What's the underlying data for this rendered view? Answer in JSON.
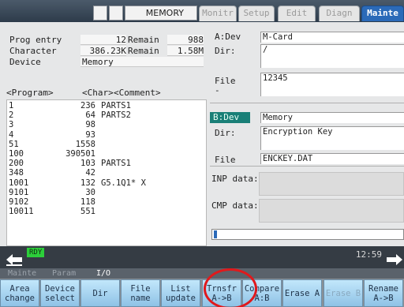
{
  "topbar": {
    "mode": "MEMORY",
    "tabs": [
      "Monitr",
      "Setup",
      "Edit",
      "Diagn",
      "Mainte"
    ],
    "active_tab_index": 4
  },
  "info": {
    "prog_entry_label": "Prog entry",
    "prog_entry_value": "12",
    "remain_label": "Remain",
    "prog_remain_value": "988",
    "character_label": "Character",
    "character_value": "386.23K",
    "char_remain_value": "1.58M",
    "device_label": "Device",
    "device_value": "Memory"
  },
  "list_header": {
    "program": "<Program>",
    "char": "<Char>",
    "comment": "<Comment>"
  },
  "programs": [
    {
      "name": "1",
      "size": "236",
      "comment": "PARTS1"
    },
    {
      "name": "2",
      "size": "64",
      "comment": "PARTS2"
    },
    {
      "name": "3",
      "size": "98",
      "comment": ""
    },
    {
      "name": "4",
      "size": "93",
      "comment": ""
    },
    {
      "name": "51",
      "size": "1558",
      "comment": ""
    },
    {
      "name": "100",
      "size": "390501",
      "comment": ""
    },
    {
      "name": "200",
      "size": "103",
      "comment": "PARTS1"
    },
    {
      "name": "348",
      "size": "42",
      "comment": ""
    },
    {
      "name": "1001",
      "size": "132",
      "comment": "G5.1Q1* X"
    },
    {
      "name": "9101",
      "size": "30",
      "comment": ""
    },
    {
      "name": "9102",
      "size": "118",
      "comment": ""
    },
    {
      "name": "10011",
      "size": "551",
      "comment": ""
    }
  ],
  "device_a": {
    "dev_label": "A:Dev",
    "dev_value": "M-Card",
    "dir_label": "Dir:",
    "dir_value": "/",
    "file_label": "File",
    "file_value": "12345",
    "extra_label": "-"
  },
  "device_b": {
    "dev_label": "B:Dev",
    "dev_value": "Memory",
    "dir_label": "Dir:",
    "dir_value": "Encryption Key",
    "file_label": "File",
    "file_value": "ENCKEY.DAT"
  },
  "inp_data_label": "INP data:",
  "cmp_data_label": "CMP data:",
  "status": {
    "ready": "RDY",
    "time": "12:59"
  },
  "captions": {
    "mainte": "Mainte",
    "param": "Param",
    "io": "I/O"
  },
  "softkeys": [
    {
      "line1": "Area",
      "line2": "change",
      "enabled": true
    },
    {
      "line1": "Device",
      "line2": "select",
      "enabled": true
    },
    {
      "line1": "Dir",
      "line2": "",
      "enabled": true
    },
    {
      "line1": "File",
      "line2": "name",
      "enabled": true
    },
    {
      "line1": "List",
      "line2": "update",
      "enabled": true
    },
    {
      "line1": "Trnsfr",
      "line2": "A->B",
      "enabled": true
    },
    {
      "line1": "Compare",
      "line2": "A:B",
      "enabled": true
    },
    {
      "line1": "Erase A",
      "line2": "",
      "enabled": true
    },
    {
      "line1": "Erase B",
      "line2": "",
      "enabled": false
    },
    {
      "line1": "Rename",
      "line2": "A->B",
      "enabled": true
    }
  ],
  "colors": {
    "active_tab": "#2b6ab8",
    "ready_badge": "#2ccf3a",
    "highlight_ring": "#e0191c",
    "softkey": "#a9d6f2",
    "dev_b_highlight": "#197f77"
  }
}
